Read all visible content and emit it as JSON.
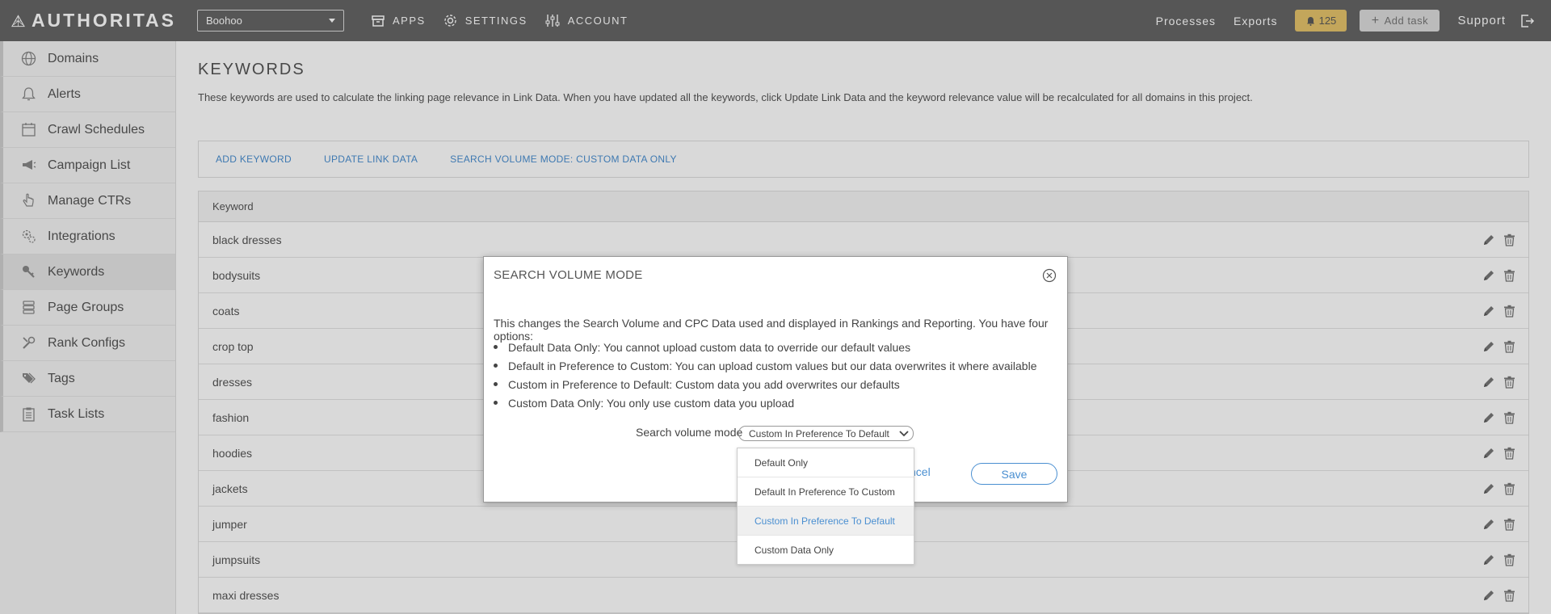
{
  "topbar": {
    "logo_text": "AUTHORITAS",
    "project": "Boohoo",
    "nav": [
      {
        "label": "APPS",
        "icon": "apps-icon"
      },
      {
        "label": "SETTINGS",
        "icon": "gear-icon"
      },
      {
        "label": "ACCOUNT",
        "icon": "sliders-icon"
      }
    ],
    "processes": "Processes",
    "exports": "Exports",
    "notifications_count": "125",
    "add_task": "Add task",
    "support": "Support"
  },
  "sidebar": {
    "items": [
      {
        "label": "Domains",
        "icon": "globe-icon"
      },
      {
        "label": "Alerts",
        "icon": "bell-icon"
      },
      {
        "label": "Crawl Schedules",
        "icon": "calendar-icon"
      },
      {
        "label": "Campaign List",
        "icon": "megaphone-icon"
      },
      {
        "label": "Manage CTRs",
        "icon": "hand-pointer-icon"
      },
      {
        "label": "Integrations",
        "icon": "cogs-icon"
      },
      {
        "label": "Keywords",
        "icon": "key-icon"
      },
      {
        "label": "Page Groups",
        "icon": "stack-icon"
      },
      {
        "label": "Rank Configs",
        "icon": "tools-icon"
      },
      {
        "label": "Tags",
        "icon": "tags-icon"
      },
      {
        "label": "Task Lists",
        "icon": "clipboard-icon"
      }
    ],
    "active_index": 6
  },
  "main": {
    "title": "KEYWORDS",
    "description": "These keywords are used to calculate the linking page relevance in Link Data. When you have updated all the keywords, click Update Link Data and the keyword relevance value will be recalculated for all domains in this project.",
    "actions": [
      "ADD KEYWORD",
      "UPDATE LINK DATA",
      "SEARCH VOLUME MODE: CUSTOM DATA ONLY"
    ],
    "table": {
      "header": "Keyword",
      "rows": [
        "black dresses",
        "bodysuits",
        "coats",
        "crop top",
        "dresses",
        "fashion",
        "hoodies",
        "jackets",
        "jumper",
        "jumpsuits",
        "maxi dresses"
      ]
    }
  },
  "modal": {
    "title": "SEARCH VOLUME MODE",
    "intro": "This changes the Search Volume and CPC Data used and displayed in Rankings and Reporting. You have four options:",
    "options_desc": [
      "Default Data Only: You cannot upload custom data to override our default values",
      "Default in Preference to Custom: You can upload custom values but our data overwrites it where available",
      "Custom in Preference to Default: Custom data you add overwrites our defaults",
      "Custom Data Only: You only use custom data you upload"
    ],
    "select_label": "Search volume mode",
    "select_value": "Custom In Preference To Default",
    "cancel_label": "ncel",
    "save_label": "Save"
  },
  "dropdown": {
    "options": [
      "Default Only",
      "Default In Preference To Custom",
      "Custom In Preference To Default",
      "Custom Data Only"
    ],
    "selected_index": 2
  },
  "colors": {
    "topbar": "#656565",
    "accent": "#4a8fd1",
    "badge": "#e5c46b"
  }
}
